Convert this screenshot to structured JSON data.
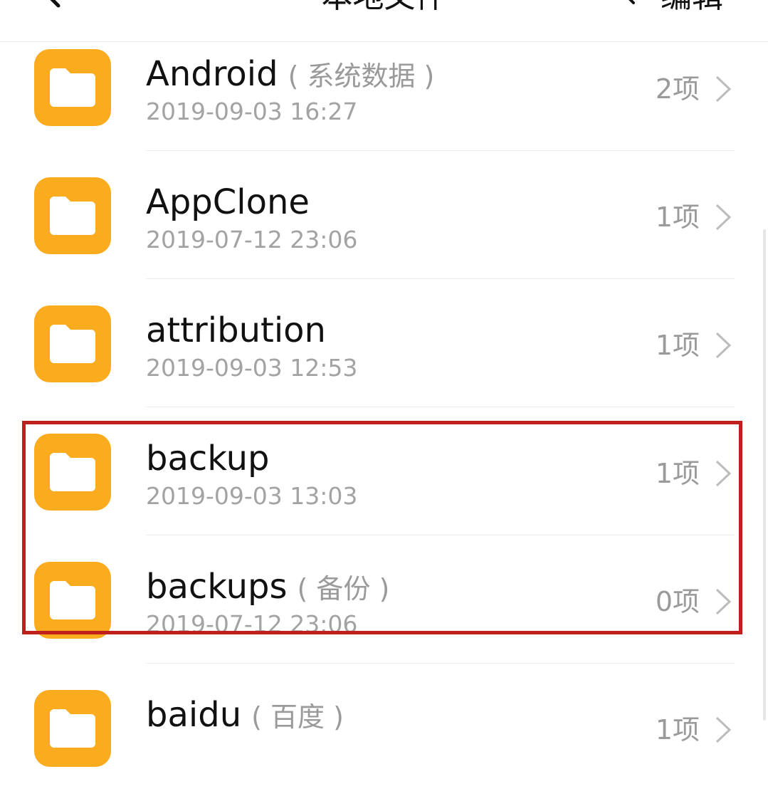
{
  "header": {
    "title": "本地文件",
    "edit_label": "编辑",
    "back_icon": "back-icon",
    "search_icon": "search-icon"
  },
  "files": [
    {
      "name": "Android",
      "alias": "( 系统数据 )",
      "date": "2019-09-03 16:27",
      "count": "2项",
      "icon": "folder-icon"
    },
    {
      "name": "AppClone",
      "alias": "",
      "date": "2019-07-12 23:06",
      "count": "1项",
      "icon": "folder-icon"
    },
    {
      "name": "attribution",
      "alias": "",
      "date": "2019-09-03 12:53",
      "count": "1项",
      "icon": "folder-icon"
    },
    {
      "name": "backup",
      "alias": "",
      "date": "2019-09-03 13:03",
      "count": "1项",
      "icon": "folder-icon"
    },
    {
      "name": "backups",
      "alias": "( 备份 )",
      "date": "2019-07-12 23:06",
      "count": "0项",
      "icon": "folder-icon"
    },
    {
      "name": "baidu",
      "alias": "( 百度 )",
      "date": "",
      "count": "1项",
      "icon": "folder-icon"
    }
  ],
  "colors": {
    "folder": "#fbac1e",
    "highlight": "#c0201b",
    "secondary_text": "#a3a3a3"
  }
}
